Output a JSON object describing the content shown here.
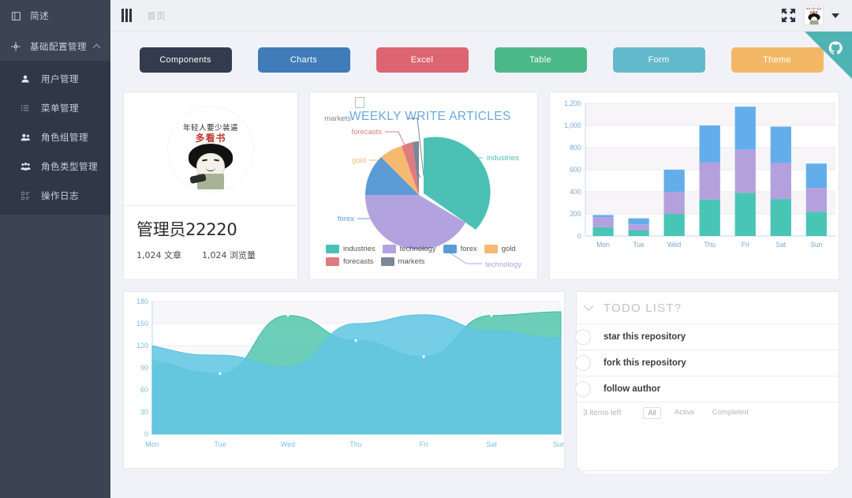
{
  "sidebar": {
    "brand": {
      "label": "简述",
      "icon": "book-icon"
    },
    "group": {
      "label": "基础配置管理",
      "icon": "gear-icon",
      "caret": "⌃"
    },
    "items": [
      {
        "label": "用户管理",
        "icon": "user-icon"
      },
      {
        "label": "菜单管理",
        "icon": "list-icon"
      },
      {
        "label": "角色组管理",
        "icon": "users-icon"
      },
      {
        "label": "角色类型管理",
        "icon": "group-icon"
      },
      {
        "label": "操作日志",
        "icon": "log-icon"
      }
    ]
  },
  "topbar": {
    "menu_icon": "hamburger-icon",
    "breadcrumb": "首页",
    "expand_icon": "fullscreen-icon",
    "avatar_icon": "user-avatar",
    "dropdown_icon": "caret-down-icon",
    "github_ribbon": "github-octocat-icon"
  },
  "buttons": [
    {
      "label": "Components",
      "color": "#333c4e"
    },
    {
      "label": "Charts",
      "color": "#3f7cb8"
    },
    {
      "label": "Excel",
      "color": "#dd6572"
    },
    {
      "label": "Table",
      "color": "#4cb888"
    },
    {
      "label": "Form",
      "color": "#63b9cc"
    },
    {
      "label": "Theme",
      "color": "#f3b866"
    }
  ],
  "profile": {
    "avatar_text_top": "年轻人要少装逼",
    "avatar_text_bottom": "多看书",
    "name": "管理员22220",
    "stat_articles": "1,024 文章",
    "stat_views": "1,024 浏览量"
  },
  "todo": {
    "title": "TODO LIST?",
    "chevron": "⌄",
    "items": [
      {
        "label": "star this repository",
        "checked": false
      },
      {
        "label": "fork this repository",
        "checked": false
      },
      {
        "label": "follow author",
        "checked": false
      }
    ],
    "count_text": "3 items left",
    "filters": [
      {
        "label": "All",
        "active": true
      },
      {
        "label": "Active",
        "active": false
      },
      {
        "label": "Completed",
        "active": false
      }
    ]
  },
  "chart_data": [
    {
      "id": "pie",
      "type": "pie",
      "title": "WEEKLY WRITE ARTICLES",
      "title_color": "#6aa9e0",
      "legend_position": "bottom",
      "labels": [
        "industries",
        "technology",
        "forex",
        "gold",
        "forecasts",
        "markets"
      ],
      "values": [
        320,
        240,
        100,
        45,
        14,
        6
      ],
      "colors": [
        "#4dc0b5",
        "#b3a2e0",
        "#5b9bd5",
        "#f5b971",
        "#e07a80",
        "#7b8699"
      ],
      "annotations": [
        "industries",
        "technology",
        "forex",
        "gold",
        "forecasts",
        "markets"
      ],
      "exploded_slice": "industries"
    },
    {
      "id": "bar",
      "type": "bar",
      "stacked": true,
      "categories": [
        "Mon",
        "Tue",
        "Wed",
        "Thu",
        "Fri",
        "Sat",
        "Sun"
      ],
      "series": [
        {
          "name": "teal",
          "color": "#49c5b6",
          "values": [
            80,
            50,
            200,
            330,
            390,
            335,
            220
          ]
        },
        {
          "name": "purple",
          "color": "#b4a0dd",
          "values": [
            90,
            55,
            200,
            335,
            390,
            325,
            215
          ]
        },
        {
          "name": "blue",
          "color": "#63aeea",
          "values": [
            20,
            55,
            200,
            335,
            390,
            330,
            220
          ]
        }
      ],
      "ylim": [
        0,
        1200
      ],
      "yticks": [
        "0",
        "200",
        "400",
        "600",
        "800",
        "1,000",
        "1,200"
      ],
      "grid": true,
      "tick_color": "#7aa7d4"
    },
    {
      "id": "area",
      "type": "area",
      "categories": [
        "Mon",
        "Tue",
        "Wed",
        "Thu",
        "Fri",
        "Sat",
        "Sun"
      ],
      "series": [
        {
          "name": "green",
          "color": "#4dc3ab",
          "values": [
            100,
            82,
            161,
            127,
            105,
            161,
            166
          ]
        },
        {
          "name": "blue",
          "color": "#63c6e2",
          "values": [
            120,
            107,
            91,
            150,
            162,
            140,
            130
          ]
        }
      ],
      "ylim": [
        0,
        180
      ],
      "yticks": [
        "0",
        "30",
        "60",
        "90",
        "120",
        "150",
        "180"
      ],
      "grid": true,
      "tick_color": "#7fbfe0"
    }
  ]
}
